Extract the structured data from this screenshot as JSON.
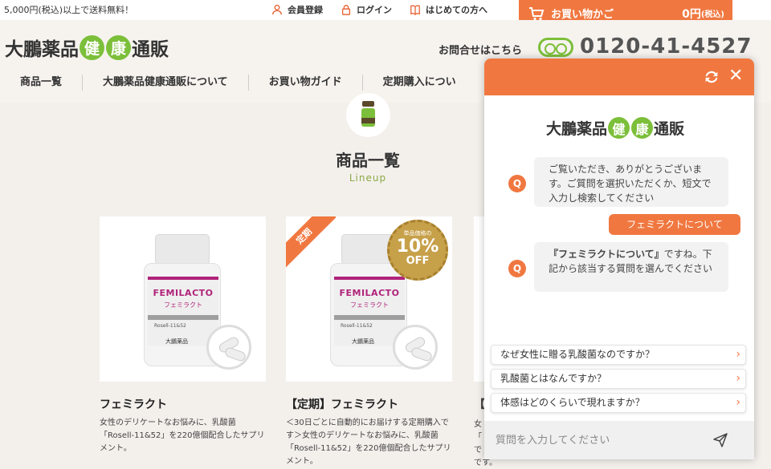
{
  "topbar": {
    "promo": "5,000円(税込)以上で送料無料！",
    "links": [
      "会員登録",
      "ログイン",
      "はじめての方へ"
    ],
    "cart": {
      "label": "お買い物かご",
      "total": "0円",
      "tax": "(税込)"
    }
  },
  "header": {
    "logo": {
      "prefix": "大鵬薬品",
      "char1": "健",
      "char2": "康",
      "suffix": "通販"
    },
    "contact_label": "お問合せはこちら",
    "phone": "0120-41-4527",
    "nav": [
      "商品一覧",
      "大鵬薬品健康通販について",
      "お買い物ガイド",
      "定期購入につい"
    ]
  },
  "main": {
    "title": "商品一覧",
    "subtitle": "Lineup",
    "products": [
      {
        "name": "フェミラクト",
        "desc": "女性のデリケートなお悩みに、乳酸菌「Rosell-11&52」を220億個配合したサプリメント。",
        "jar": {
          "brand": "FEMILACTO",
          "brand_kana": "フェミラクト",
          "spec": "Rosell-11&52",
          "maker": "大鵬薬品"
        }
      },
      {
        "name": "【定期】フェミラクト",
        "desc": "＜30日ごとに自動的にお届けする定期購入です＞女性のデリケートなお悩みに、乳酸菌「Rosell-11&52」を220億個配合したサプリメント。",
        "ribbon": "定期",
        "badge": {
          "top": "単品価格の",
          "value": "10%",
          "unit": "OFF"
        },
        "jar": {
          "brand": "FEMILACTO",
          "brand_kana": "フェミラクト",
          "spec": "Rosell-11&52",
          "maker": "大鵬薬品"
        }
      }
    ],
    "peek": {
      "name": "【",
      "desc1": "女",
      "desc2": "「",
      "desc3": "で",
      "desc4": "です。"
    }
  },
  "chat": {
    "logo": {
      "prefix": "大鵬薬品",
      "char1": "健",
      "char2": "康",
      "suffix": "通販"
    },
    "avatar_letter": "Q",
    "greeting": "ご覧いただき、ありがとうございます。ご質問を選択いただくか、短文で入力し検索してください",
    "user_message": "フェミラクトについて",
    "reply_quote": "『フェミラクトについて』",
    "reply_rest": "ですね。下記から該当する質問を選んでください",
    "faqs": [
      "なぜ女性に贈る乳酸菌なのですか？",
      "乳酸菌とはなんですか？",
      "体感はどのくらいで現れますか？"
    ],
    "input_placeholder": "質問を入力してください"
  }
}
